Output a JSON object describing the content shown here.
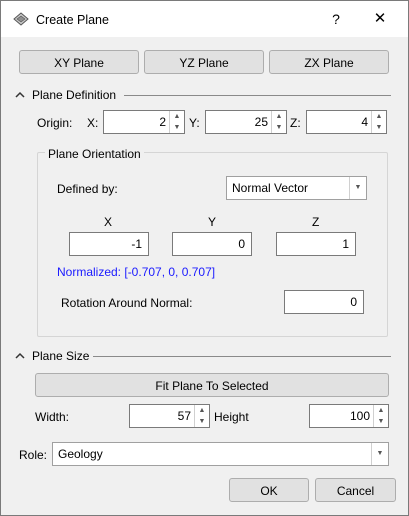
{
  "window": {
    "title": "Create Plane",
    "help": "?",
    "close": "✕"
  },
  "planes": {
    "xy": "XY Plane",
    "yz": "YZ Plane",
    "zx": "ZX Plane"
  },
  "plane_definition": {
    "header": "Plane Definition",
    "origin_label": "Origin:",
    "x_label": "X:",
    "x_value": "2",
    "y_label": "Y:",
    "y_value": "25",
    "z_label": "Z:",
    "z_value": "4"
  },
  "orientation": {
    "header": "Plane Orientation",
    "defined_by_label": "Defined by:",
    "defined_by_value": "Normal Vector",
    "col_x": "X",
    "col_y": "Y",
    "col_z": "Z",
    "vx": "-1",
    "vy": "0",
    "vz": "1",
    "normalized": "Normalized: [-0.707, 0, 0.707]",
    "rotation_label": "Rotation Around Normal:",
    "rotation_value": "0",
    "normalized_color": "#1a1aff"
  },
  "plane_size": {
    "header": "Plane Size",
    "fit_button": "Fit Plane To Selected",
    "width_label": "Width:",
    "width_value": "57",
    "height_label": "Height",
    "height_value": "100"
  },
  "role": {
    "label": "Role:",
    "value": "Geology"
  },
  "buttons": {
    "ok": "OK",
    "cancel": "Cancel"
  }
}
